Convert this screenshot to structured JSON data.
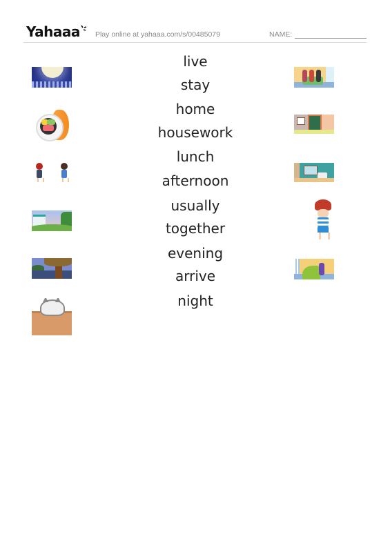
{
  "header": {
    "logo_text": "Yahaaa",
    "play_online": "Play online at yahaaa.com/s/00485079",
    "name_label": "NAME:"
  },
  "words": [
    "live",
    "stay",
    "home",
    "housework",
    "lunch",
    "afternoon",
    "usually",
    "together",
    "evening",
    "arrive",
    "night"
  ],
  "left_pictures": [
    {
      "name": "moon-night-city-picture"
    },
    {
      "name": "sushi-roll-picture"
    },
    {
      "name": "two-girls-picture"
    },
    {
      "name": "castle-hill-picture"
    },
    {
      "name": "tree-by-lake-evening-picture"
    },
    {
      "name": "cat-in-box-picture"
    }
  ],
  "right_pictures": [
    {
      "name": "family-on-sofa-picture"
    },
    {
      "name": "arrive-home-door-picture"
    },
    {
      "name": "living-room-picture"
    },
    {
      "name": "boy-carrying-basket-picture"
    },
    {
      "name": "kids-slide-picture"
    }
  ],
  "colors": {
    "text": "#222222",
    "muted": "#888888",
    "divider": "#d8d8d8"
  }
}
